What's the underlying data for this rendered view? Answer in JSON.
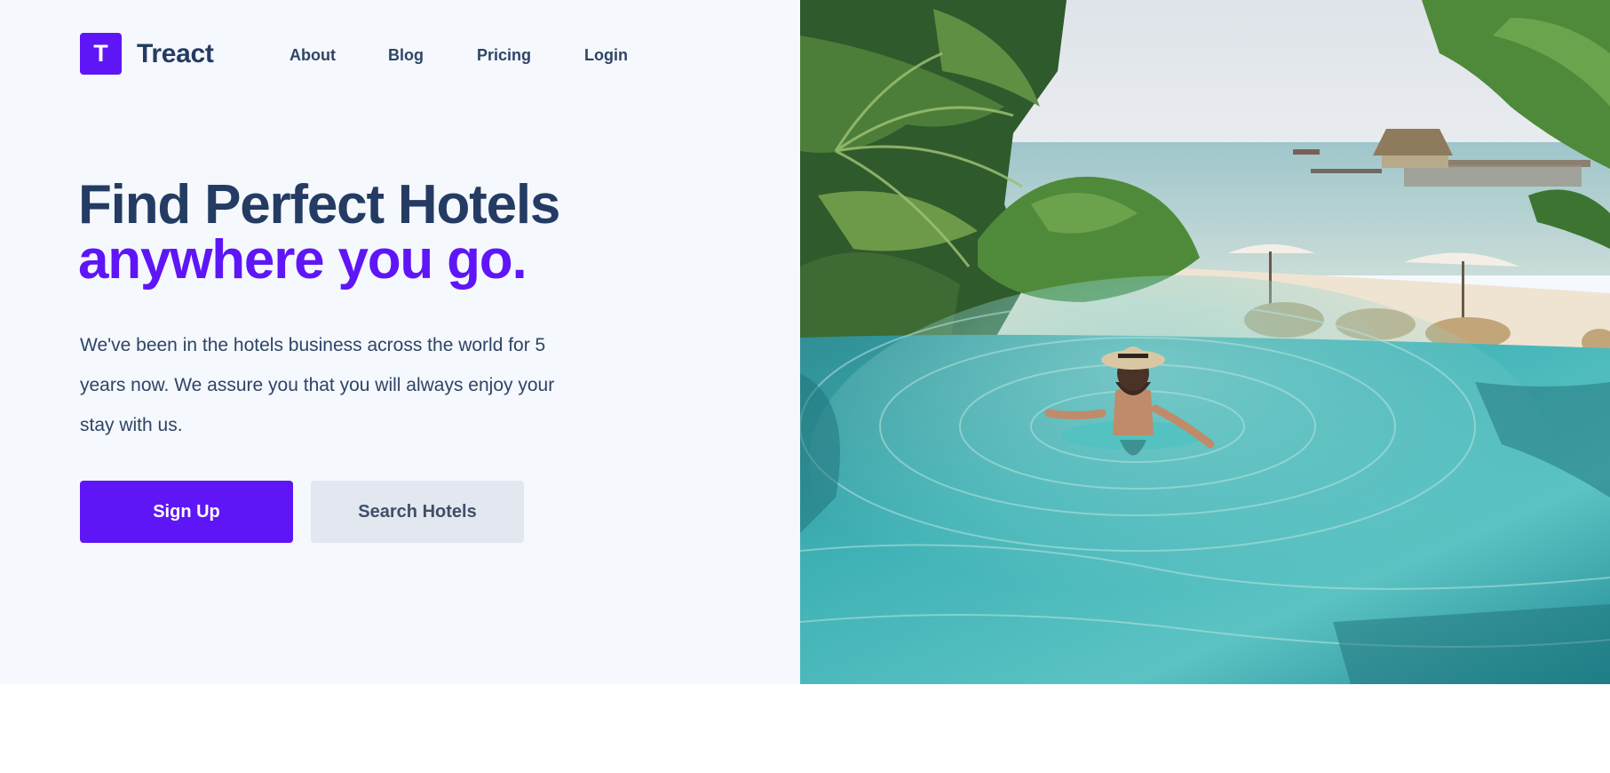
{
  "brand": {
    "logo_letter": "T",
    "name": "Treact",
    "accent_color": "#5f16f6"
  },
  "nav": {
    "items": [
      {
        "label": "About"
      },
      {
        "label": "Blog"
      },
      {
        "label": "Pricing"
      },
      {
        "label": "Login"
      }
    ]
  },
  "hero": {
    "headline_line1": "Find Perfect Hotels",
    "headline_line2": "anywhere you go.",
    "description": "We've been in the hotels business across the world for 5 years now. We assure you that you will always enjoy your stay with us.",
    "primary_button": "Sign Up",
    "secondary_button": "Search Hotels",
    "image_icon": "infinity-pool-beach-photo"
  },
  "colors": {
    "heading": "#243b63",
    "accent": "#5f16f6",
    "background": "#f5f8fc",
    "secondary_button_bg": "#e2e7f0"
  }
}
